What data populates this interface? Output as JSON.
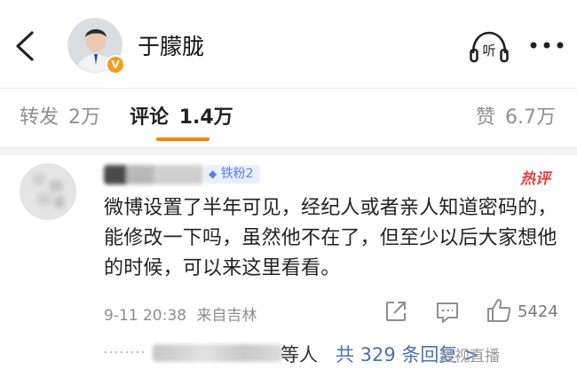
{
  "header": {
    "username": "于朦胧",
    "verified_badge": "V",
    "listen_label": "听"
  },
  "tabs": {
    "repost_label": "转发",
    "repost_count": "2万",
    "comment_label": "评论",
    "comment_count": "1.4万",
    "like_label": "赞",
    "like_count": "6.7万"
  },
  "comment": {
    "fan_badge": "铁粉2",
    "hot_tag": "热评",
    "text": "微博设置了半年可见，经纪人或者亲人知道密码的，能修改一下吗，虽然他不在了，但至少以后大家想他的时候，可以来这里看看。",
    "time": "9-11 20:38",
    "location": "来自吉林",
    "like_count": "5424"
  },
  "replies": {
    "who": "等人",
    "link": "共 329 条回复 >"
  },
  "watermark": "经视直播",
  "colors": {
    "accent": "#ff8200",
    "link": "#4a6fb5",
    "hot": "#e2433c",
    "verified": "#f59a1a"
  },
  "icons": [
    "back-arrow-icon",
    "verified-v-icon",
    "listen-icon",
    "more-icon",
    "share-icon",
    "comment-icon",
    "like-icon",
    "fan-diamond-icon"
  ]
}
